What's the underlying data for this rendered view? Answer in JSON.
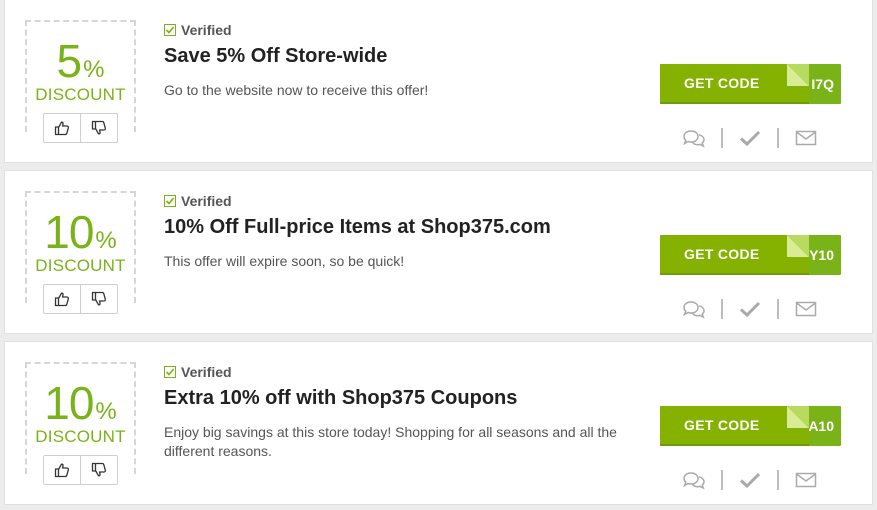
{
  "coupons": [
    {
      "discount_value": "5",
      "discount_sign": "%",
      "discount_word": "DISCOUNT",
      "verified_label": "Verified",
      "title": "Save 5% Off Store-wide",
      "description": "Go to the website now to receive this offer!",
      "button_label": "GET CODE",
      "code_peek": "I7Q"
    },
    {
      "discount_value": "10",
      "discount_sign": "%",
      "discount_word": "DISCOUNT",
      "verified_label": "Verified",
      "title": "10% Off Full-price Items at Shop375.com",
      "description": "This offer will expire soon, so be quick!",
      "button_label": "GET CODE",
      "code_peek": "Y10"
    },
    {
      "discount_value": "10",
      "discount_sign": "%",
      "discount_word": "DISCOUNT",
      "verified_label": "Verified",
      "title": "Extra 10% off with Shop375 Coupons",
      "description": "Enjoy big savings at this store today! Shopping for all seasons and all the different reasons.",
      "button_label": "GET CODE",
      "code_peek": "A10"
    }
  ],
  "icons": {
    "thumbs_up": "thumbs-up-icon",
    "thumbs_down": "thumbs-down-icon",
    "verified": "checkbox-checked-icon",
    "comments": "comments-icon",
    "works": "checkmark-icon",
    "share": "envelope-icon"
  },
  "colors": {
    "accent": "#7ab317",
    "button": "#85b200",
    "card": "#ffffff",
    "page": "#ececec"
  }
}
